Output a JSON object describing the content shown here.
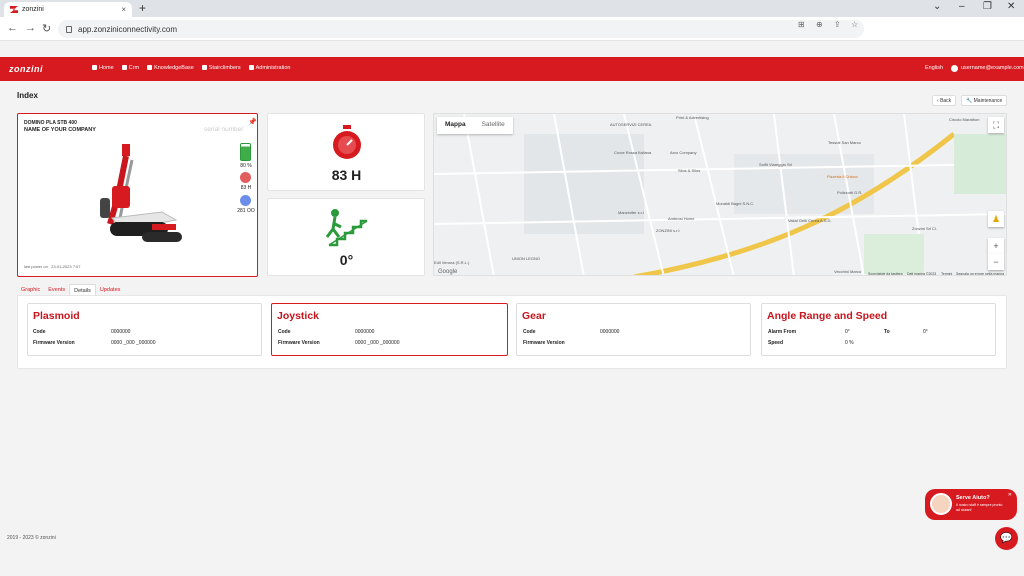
{
  "browser": {
    "tab_title": "zonzini",
    "url": "app.zonziniconnectivity.com"
  },
  "header": {
    "logo": "zonzini",
    "nav": [
      "Home",
      "Crm",
      "KnowledgeBase",
      "Stairclimbers",
      "Administration"
    ],
    "language": "English",
    "user": "username@example.com"
  },
  "page": {
    "title": "Index",
    "back_label": "Back",
    "maintenance_label": "Maintenance"
  },
  "device": {
    "model": "DOMINO PLA STB 400",
    "company": "NAME OF YOUR COMPANY",
    "serial_placeholder": "serial number",
    "battery": "80 %",
    "hours": "83 H",
    "count": "281 OO",
    "last_power": "last power on",
    "last_power_date": "23-01-2023 7:07"
  },
  "kpis": {
    "hours": "83 H",
    "angle": "0°"
  },
  "map": {
    "type_map": "Mappa",
    "type_satellite": "Satellite",
    "labels": [
      "AUTOSERVIZI CEREA",
      "Print & Advertising",
      "Circolo Marathon",
      "Tessuti San Marco",
      "Croce Rossa Italiana",
      "Arco Company",
      "Solfit Viareggio Srl",
      "Silos & Silos",
      "Monaldi Bagni S.N.C.",
      "Manzinifer s.r.l",
      "Ambrosi Home",
      "Polizzotti G.R.",
      "Vakal Gelk Cerea A.S.D.",
      "Pizzeria Il Chicco",
      "Zonzini Srl Cl.",
      "ZONZINI s.r.l.",
      "UNION LEGNO",
      "Edil Verona (S.R.L.)",
      "Vecchini Marco"
    ],
    "footer": [
      "Scorciatoie da tastiera",
      "Dati mappa ©2023",
      "Termini",
      "Segnala un errore nella mappa"
    ],
    "google": "Google"
  },
  "tabs": [
    "Graphic",
    "Events",
    "Details",
    "Updates"
  ],
  "active_tab": "Details",
  "details": {
    "plasmoid": {
      "title": "Plasmoid",
      "code_label": "Code",
      "code": "0000000",
      "fw_label": "Firmware Version",
      "fw": "0000 _000 _000000"
    },
    "joystick": {
      "title": "Joystick",
      "code_label": "Code",
      "code": "0000000",
      "fw_label": "Firmware Version",
      "fw": "0000 _000 _000000"
    },
    "gear": {
      "title": "Gear",
      "code_label": "Code",
      "code": "0000000",
      "fw_label": "Firmware Version",
      "fw": ""
    },
    "angle": {
      "title": "Angle Range and Speed",
      "alarm_label": "Alarm From",
      "alarm": "0°",
      "to_label": "To",
      "to": "0°",
      "speed_label": "Speed",
      "speed": "0 %"
    }
  },
  "footer": "2019 - 2023 © zonzini",
  "help": {
    "title": "Serve Aiuto?",
    "text": "Il nostro staff è sempre pronto ad aiutarti"
  }
}
